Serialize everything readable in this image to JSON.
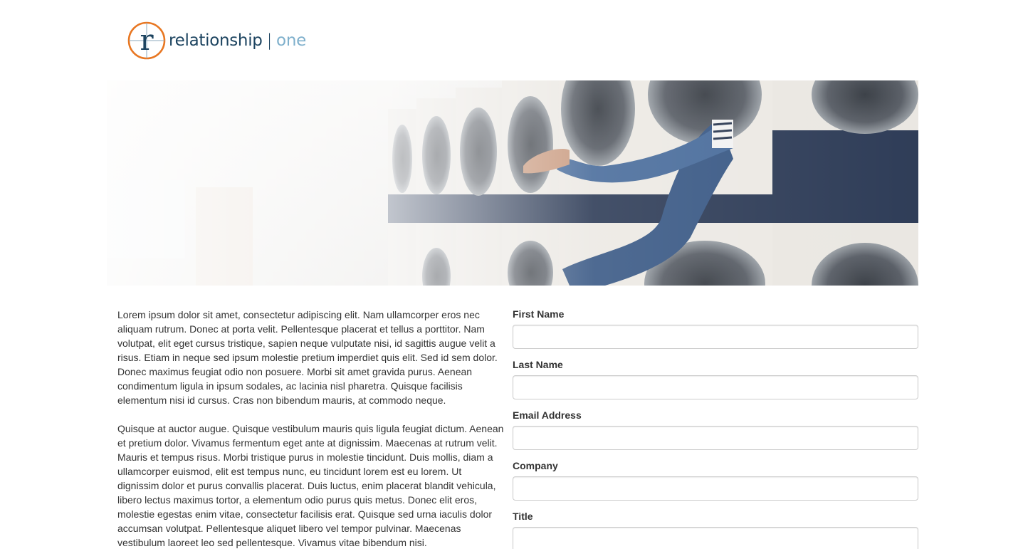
{
  "brand": {
    "name_primary": "relationship",
    "separator": "|",
    "name_secondary": "one",
    "logo_letter": "r",
    "colors": {
      "ring": "#e87722",
      "navy": "#1d4460",
      "light_blue": "#7fb0cc"
    }
  },
  "hero": {
    "icon": "laundromat-photo"
  },
  "content": {
    "paragraphs": [
      "Lorem ipsum dolor sit amet, consectetur adipiscing elit. Nam ullamcorper eros nec aliquam rutrum. Donec at porta velit. Pellentesque placerat et tellus a porttitor. Nam volutpat, elit eget cursus tristique, sapien neque vulputate nisi, id sagittis augue velit a risus. Etiam in neque sed ipsum molestie pretium imperdiet quis elit. Sed id sem dolor. Donec maximus feugiat odio non posuere. Morbi sit amet gravida purus. Aenean condimentum ligula in ipsum sodales, ac lacinia nisl pharetra. Quisque facilisis elementum nisi id cursus. Cras non bibendum mauris, at commodo neque.",
      "Quisque at auctor augue. Quisque vestibulum mauris quis ligula feugiat dictum. Aenean et pretium dolor. Vivamus fermentum eget ante at dignissim. Maecenas at rutrum velit. Mauris et tempus risus. Morbi tristique purus in molestie tincidunt. Duis mollis, diam a ullamcorper euismod, elit est tempus nunc, eu tincidunt lorem est eu lorem. Ut dignissim dolor et purus convallis placerat. Duis luctus, enim placerat blandit vehicula, libero lectus maximus tortor, a elementum odio purus quis metus. Donec elit eros, molestie egestas enim vitae, consectetur facilisis erat. Quisque sed urna iaculis dolor accumsan volutpat. Pellentesque aliquet libero vel tempor pulvinar. Maecenas vestibulum laoreet leo sed pellentesque. Vivamus vitae bibendum nisi."
    ]
  },
  "form": {
    "fields": [
      {
        "label": "First Name",
        "value": "",
        "placeholder": ""
      },
      {
        "label": "Last Name",
        "value": "",
        "placeholder": ""
      },
      {
        "label": "Email Address",
        "value": "",
        "placeholder": ""
      },
      {
        "label": "Company",
        "value": "",
        "placeholder": ""
      },
      {
        "label": "Title",
        "value": "",
        "placeholder": ""
      }
    ]
  }
}
